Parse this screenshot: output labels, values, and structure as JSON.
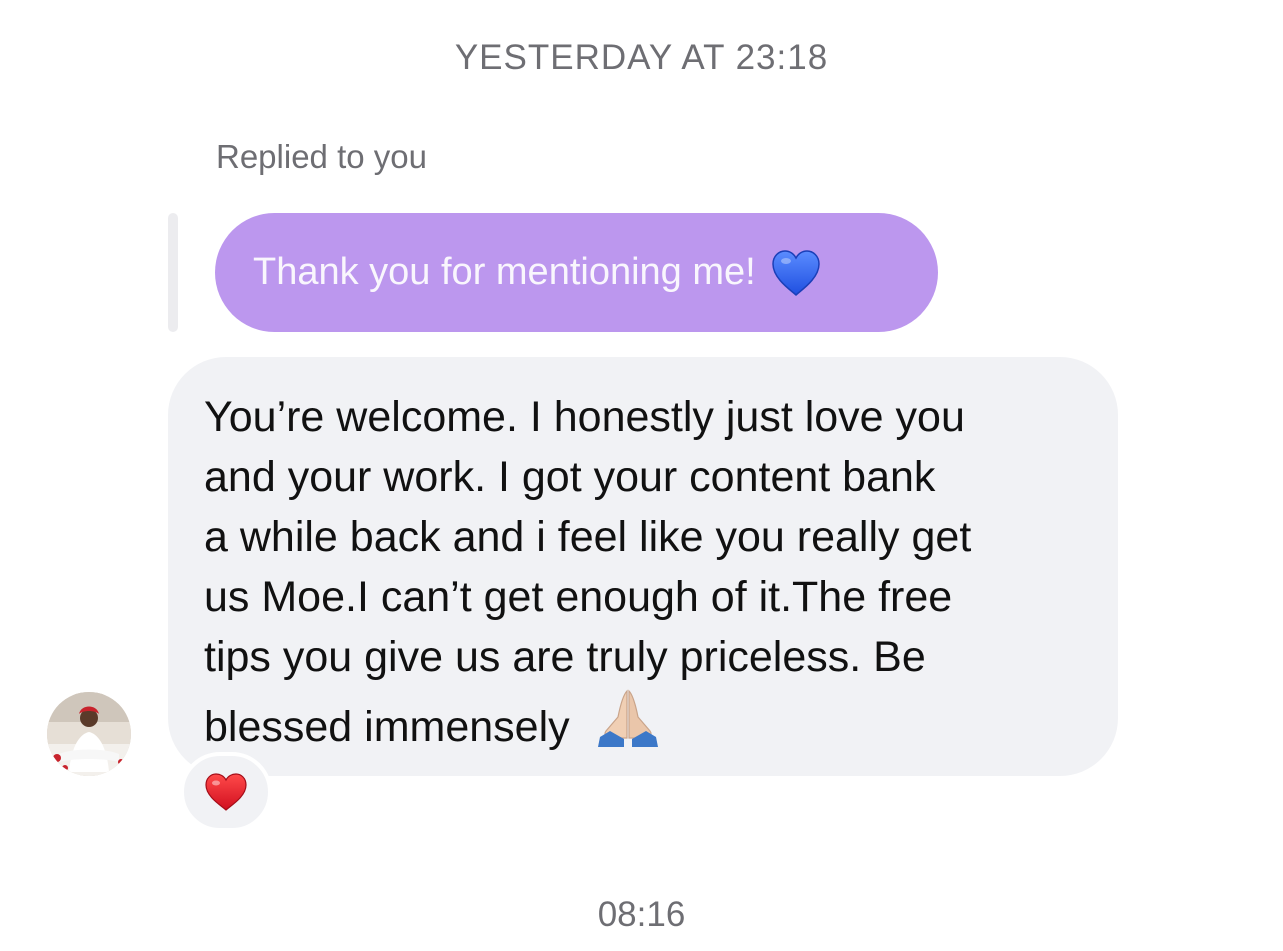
{
  "thread": {
    "date_header": "YESTERDAY AT 23:18",
    "footer_time": "08:16"
  },
  "reply": {
    "label": "Replied to you",
    "quoted_text": "Thank you for mentioning me!",
    "quoted_emoji_icon": "blue-heart-icon",
    "bubble_color": "#bc97ee"
  },
  "message": {
    "lines": [
      "You’re welcome. I honestly just love you",
      "and your work. I got your content bank",
      "a while back and i feel like you really get",
      "us Moe.I can’t get enough of it.The free",
      "tips you give us are truly priceless. Be",
      "blessed immensely"
    ],
    "trailing_emoji_icon": "folded-hands-icon",
    "bubble_color": "#f1f2f5",
    "reaction_icon": "red-heart-icon"
  },
  "sender": {
    "avatar_icon": "avatar"
  }
}
